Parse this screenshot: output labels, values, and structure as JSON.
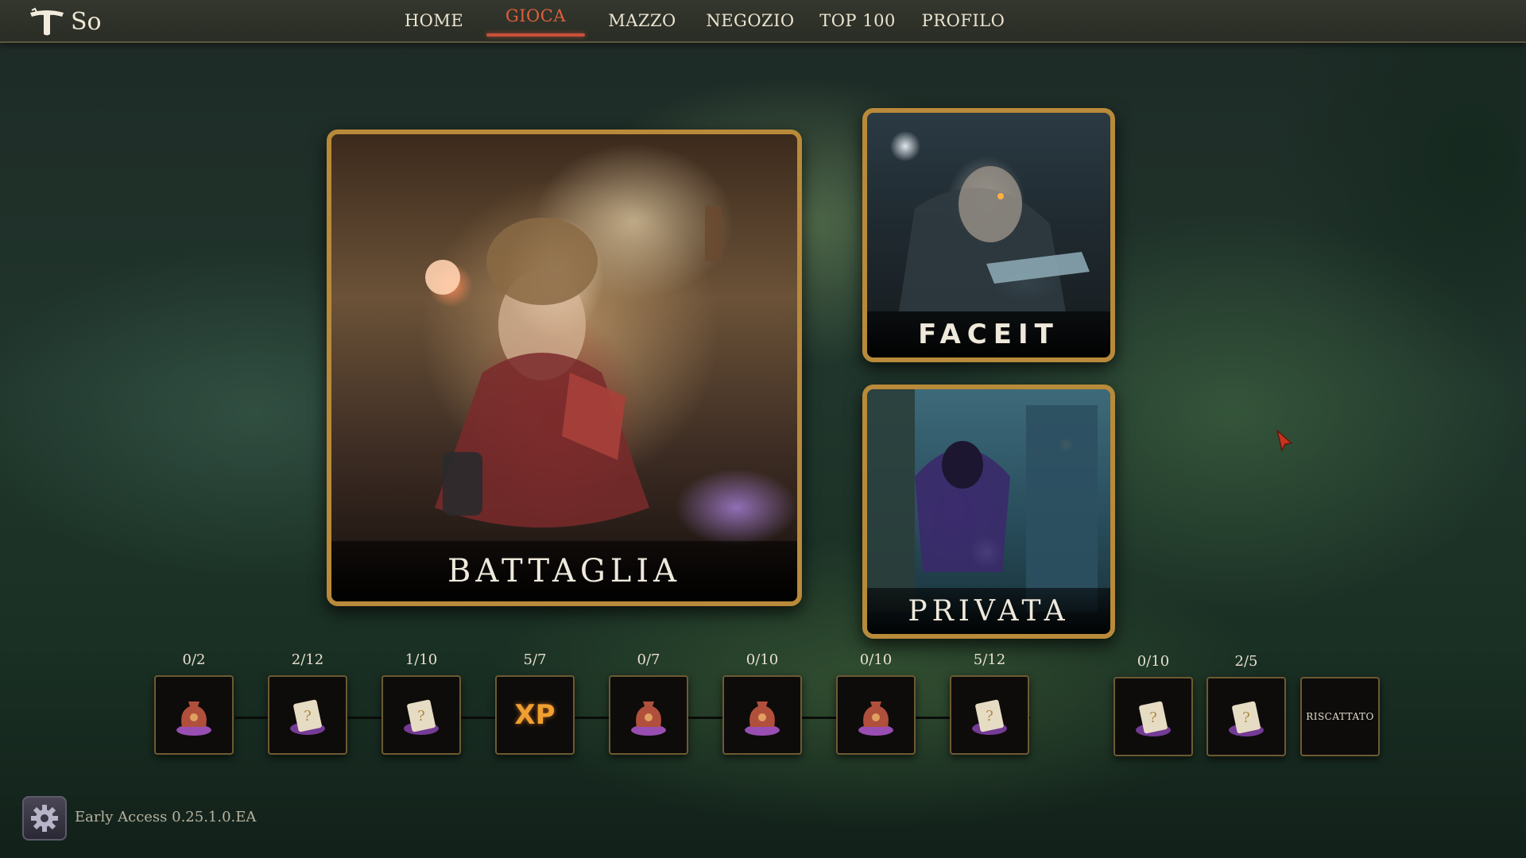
{
  "header": {
    "logo_icon": "tavern-t-logo",
    "player_name": "So",
    "nav": [
      {
        "label": "HOME",
        "active": false
      },
      {
        "label": "GIOCA",
        "active": true
      },
      {
        "label": "MAZZO",
        "active": false
      },
      {
        "label": "NEGOZIO",
        "active": false
      },
      {
        "label": "TOP 100",
        "active": false
      },
      {
        "label": "PROFILO",
        "active": false
      }
    ],
    "active_color": "#e0603c"
  },
  "modes": {
    "battle": {
      "label": "BATTAGLIA"
    },
    "faceit": {
      "label": "FACEIT"
    },
    "private": {
      "label": "PRIVATA"
    }
  },
  "rewards": [
    {
      "progress": "0/2",
      "icon": "bag-icon"
    },
    {
      "progress": "2/12",
      "icon": "card-pack-icon"
    },
    {
      "progress": "1/10",
      "icon": "card-pack-icon"
    },
    {
      "progress": "5/7",
      "icon": "xp-icon",
      "text": "XP"
    },
    {
      "progress": "0/7",
      "icon": "bag-icon"
    },
    {
      "progress": "0/10",
      "icon": "bag-icon"
    },
    {
      "progress": "0/10",
      "icon": "bag-icon"
    },
    {
      "progress": "5/12",
      "icon": "card-pack-icon"
    },
    {
      "progress": "0/10",
      "icon": "card-pack-icon"
    },
    {
      "progress": "2/5",
      "icon": "card-pack-icon"
    },
    {
      "progress": "",
      "icon": "none",
      "text": "RISCATTATO"
    }
  ],
  "footer": {
    "settings_icon": "gear-icon",
    "version": "Early Access 0.25.1.0.EA"
  },
  "colors": {
    "frame_gold": "#b88a3a",
    "xp_orange": "#f0a030"
  }
}
